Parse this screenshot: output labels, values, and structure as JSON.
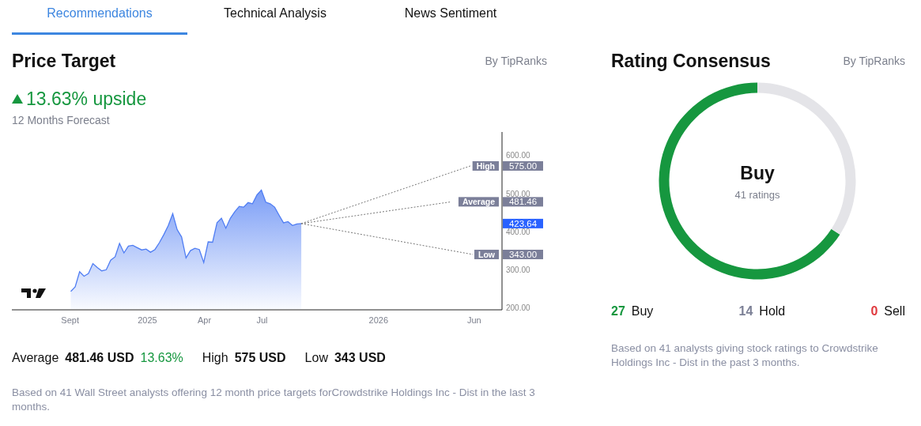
{
  "tabs": [
    {
      "label": "Recommendations",
      "selected": true
    },
    {
      "label": "Technical Analysis",
      "selected": false
    },
    {
      "label": "News Sentiment",
      "selected": false
    }
  ],
  "price_target": {
    "title": "Price Target",
    "source": "By TipRanks",
    "upside": "13.63% upside",
    "period": "12 Months Forecast",
    "chart_data": {
      "type": "line",
      "x": [
        "2024-09-02",
        "2024-09-09",
        "2024-09-16",
        "2024-09-23",
        "2024-09-30",
        "2024-10-07",
        "2024-10-14",
        "2024-10-21",
        "2024-10-28",
        "2024-11-04",
        "2024-11-11",
        "2024-11-18",
        "2024-11-25",
        "2024-12-02",
        "2024-12-09",
        "2024-12-16",
        "2024-12-23",
        "2024-12-30",
        "2025-01-06",
        "2025-01-13",
        "2025-01-20",
        "2025-01-27",
        "2025-02-03",
        "2025-02-10",
        "2025-02-17",
        "2025-02-24",
        "2025-03-03",
        "2025-03-10",
        "2025-03-17",
        "2025-03-24",
        "2025-03-31",
        "2025-04-07",
        "2025-04-14",
        "2025-04-21",
        "2025-04-28",
        "2025-05-05",
        "2025-05-12",
        "2025-05-19",
        "2025-05-26",
        "2025-06-02",
        "2025-06-09",
        "2025-06-16",
        "2025-06-23",
        "2025-06-30",
        "2025-07-07",
        "2025-07-14",
        "2025-07-21",
        "2025-07-28",
        "2025-08-04",
        "2025-08-11",
        "2025-08-18",
        "2025-08-25",
        "2025-09-01",
        "2026-04-26",
        "2026-05-26",
        "2026-05-30"
      ],
      "series": [
        {
          "color": "#4f7df3",
          "values": [
            246,
            258,
            298,
            286,
            293,
            319,
            309,
            300,
            303,
            328,
            337,
            372,
            347,
            365,
            367,
            361,
            355,
            357,
            349,
            356,
            374,
            395,
            419,
            450,
            408,
            389,
            334,
            353,
            359,
            356,
            322,
            376,
            375,
            426,
            438,
            412,
            438,
            455,
            469,
            467,
            479,
            476,
            499,
            512,
            480,
            476,
            467,
            446,
            426,
            429,
            419,
            423,
            424,
            null,
            null,
            null
          ]
        },
        {
          "name": "High",
          "color": "#777777",
          "line_style": "dashed",
          "values": [
            null,
            null,
            null,
            null,
            null,
            null,
            null,
            null,
            null,
            null,
            null,
            null,
            null,
            null,
            null,
            null,
            null,
            null,
            null,
            null,
            null,
            null,
            null,
            null,
            null,
            null,
            null,
            null,
            null,
            null,
            null,
            null,
            null,
            null,
            null,
            null,
            null,
            null,
            null,
            null,
            null,
            null,
            null,
            null,
            null,
            null,
            null,
            null,
            null,
            null,
            null,
            null,
            424,
            null,
            575,
            null
          ]
        },
        {
          "name": "Average",
          "color": "#777777",
          "line_style": "dashed",
          "values": [
            null,
            null,
            null,
            null,
            null,
            null,
            null,
            null,
            null,
            null,
            null,
            null,
            null,
            null,
            null,
            null,
            null,
            null,
            null,
            null,
            null,
            null,
            null,
            null,
            null,
            null,
            null,
            null,
            null,
            null,
            null,
            null,
            null,
            null,
            null,
            null,
            null,
            null,
            null,
            null,
            null,
            null,
            null,
            null,
            null,
            null,
            null,
            null,
            null,
            null,
            null,
            null,
            424,
            481,
            null,
            null
          ]
        },
        {
          "name": "Low",
          "color": "#777777",
          "line_style": "dashed",
          "values": [
            null,
            null,
            null,
            null,
            null,
            null,
            null,
            null,
            null,
            null,
            null,
            null,
            null,
            null,
            null,
            null,
            null,
            null,
            null,
            null,
            null,
            null,
            null,
            null,
            null,
            null,
            null,
            null,
            null,
            null,
            null,
            null,
            null,
            null,
            null,
            null,
            null,
            null,
            null,
            null,
            null,
            null,
            null,
            null,
            null,
            null,
            null,
            null,
            null,
            null,
            null,
            null,
            424,
            null,
            null,
            343
          ]
        }
      ],
      "xlim": [
        "2024-06-01",
        "2026-07-15"
      ],
      "ylim": [
        200,
        664
      ],
      "xticks": [
        {
          "value": "2024-09-01",
          "label": "Sept"
        },
        {
          "value": "2025-01-01",
          "label": "2025"
        },
        {
          "value": "2025-04-01",
          "label": "Apr"
        },
        {
          "value": "2025-07-01",
          "label": "Jul"
        },
        {
          "value": "2026-01-01",
          "label": "2026"
        },
        {
          "value": "2026-06-01",
          "label": "Jun"
        }
      ],
      "yticks": [
        {
          "value": 200,
          "label": "200.00"
        },
        {
          "value": 300,
          "label": "300.00"
        },
        {
          "value": 400,
          "label": "400.00"
        },
        {
          "value": 500,
          "label": "500.00"
        },
        {
          "value": 600,
          "label": "600.00"
        }
      ],
      "annotations": [
        "423.64",
        "575.00",
        "481.46",
        "343.00"
      ]
    },
    "summary": [
      {
        "label": "Average",
        "value": "481.46 USD",
        "change": "13.63%"
      },
      {
        "label": "High",
        "value": "575 USD"
      },
      {
        "label": "Low",
        "value": "343 USD"
      }
    ],
    "note": "Based on 41 Wall Street analysts offering 12 month price targets forCrowdstrike Holdings Inc - Dist in the last 3 months."
  },
  "rating_consensus": {
    "title": "Rating Consensus",
    "source": "By TipRanks",
    "verdict": "Buy",
    "count": "41 ratings",
    "chart_data": {
      "type": "donut",
      "categories": [
        "Buy",
        "Hold",
        "Sell"
      ],
      "values": [
        65.85,
        34.15,
        0
      ]
    },
    "breakdown": [
      {
        "count": "27",
        "color": "#16973f"
      },
      {
        "count": "14",
        "color": "#7c8096"
      },
      {
        "count": "0",
        "color": "#e0393e"
      }
    ],
    "note": "Based on 41 analysts giving stock ratings to Crowdstrike Holdings Inc - Dist in the past 3 months."
  }
}
